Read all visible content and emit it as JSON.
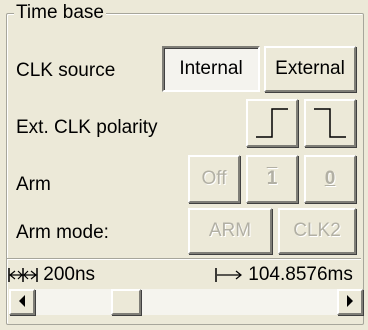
{
  "group": {
    "title": "Time base"
  },
  "clk_source": {
    "label": "CLK source",
    "internal": "Internal",
    "external": "External",
    "selected": "Internal"
  },
  "ext_clk_polarity": {
    "label": "Ext. CLK polarity",
    "rising_icon": "rising-edge-icon",
    "falling_icon": "falling-edge-icon"
  },
  "arm": {
    "label": "Arm",
    "off": "Off",
    "one": "1",
    "zero": "0"
  },
  "arm_mode": {
    "label": "Arm mode:",
    "arm": "ARM",
    "clk2": "CLK2"
  },
  "readouts": {
    "period": "200ns",
    "period_icon": "double-arrow-icon",
    "span": "104.8576ms",
    "span_icon": "right-arrow-icon"
  },
  "scrollbar": {
    "left_icon": "scroll-left-icon",
    "right_icon": "scroll-right-icon",
    "position": 0.28
  },
  "colors": {
    "face": "#ece9d8",
    "disabled_text": "#b2b0a4",
    "shadow": "#7f7e77"
  }
}
